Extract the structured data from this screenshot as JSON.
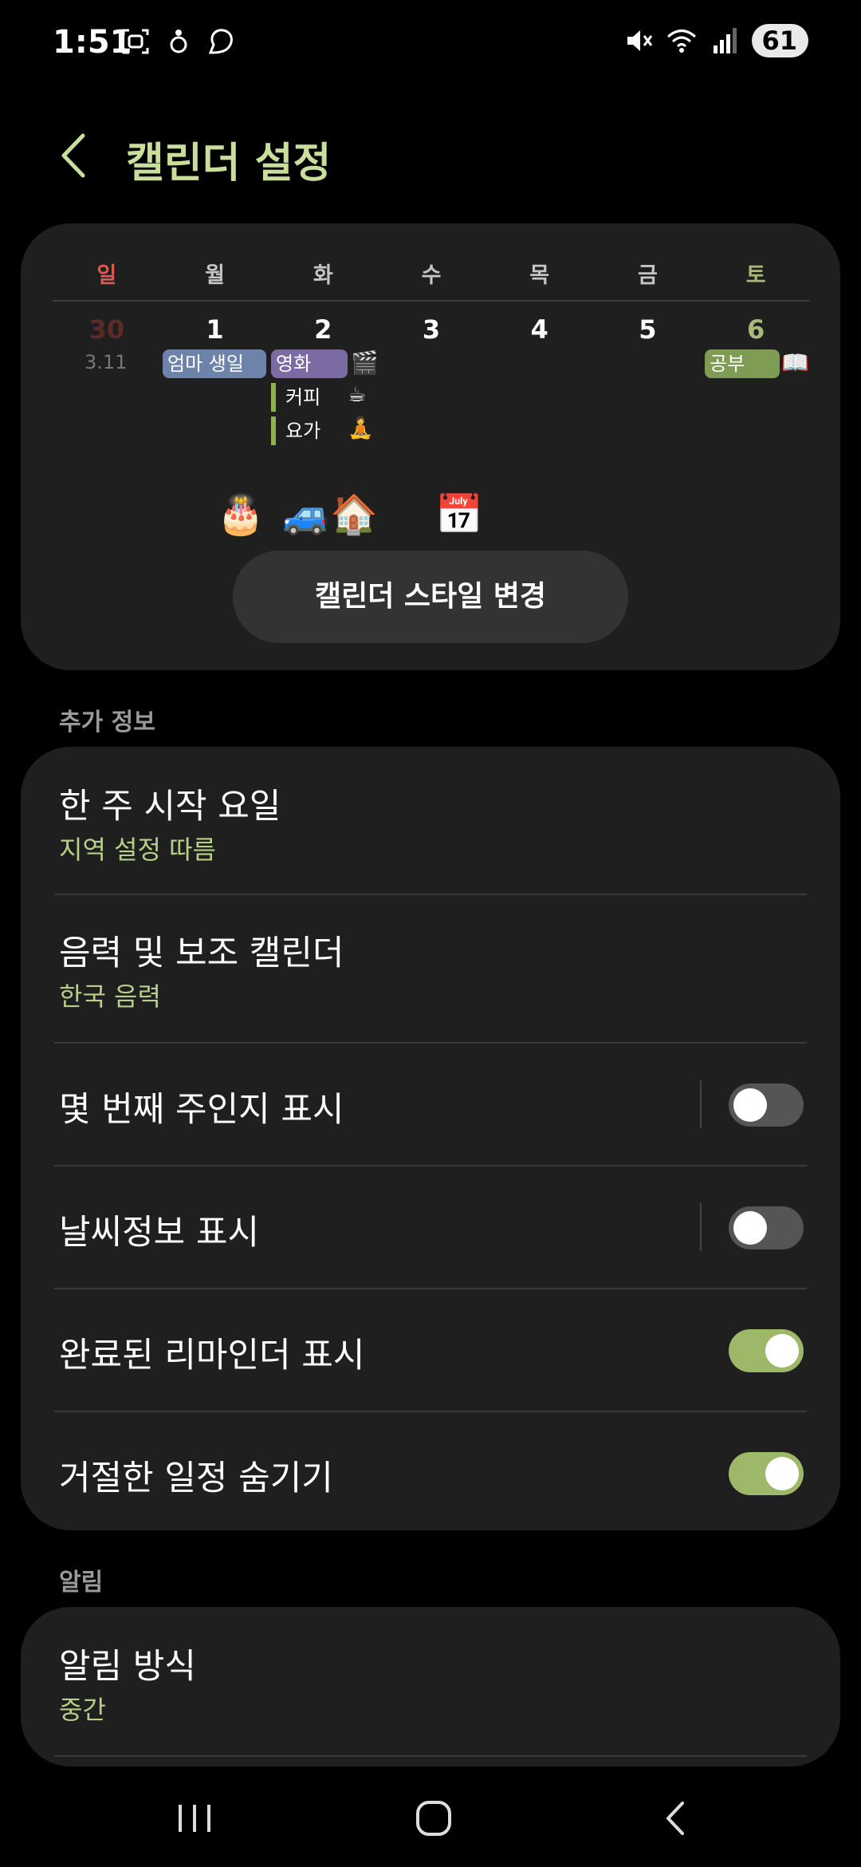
{
  "status_bar": {
    "time": "1:51",
    "battery": "61",
    "left_icons": [
      "screenshot-icon",
      "notification-icon",
      "app-notification-icon"
    ],
    "right_icons": [
      "mute-icon",
      "wifi-icon",
      "signal-icon"
    ]
  },
  "header": {
    "title": "캘린더 설정",
    "back_icon": "back-arrow-icon"
  },
  "preview": {
    "weekdays": [
      "일",
      "월",
      "화",
      "수",
      "목",
      "금",
      "토"
    ],
    "dates": [
      "30",
      "1",
      "2",
      "3",
      "4",
      "5",
      "6"
    ],
    "lunar": "3.11",
    "events": {
      "mom_birthday": "엄마 생일",
      "movie": "영화",
      "movie_emoji": "🎬",
      "study": "공부",
      "study_emoji": "📖"
    },
    "tasks": {
      "coffee": "커피",
      "coffee_emoji": "☕",
      "yoga": "요가",
      "yoga_emoji": "🧘"
    },
    "decorations": [
      "🎂",
      "🚙",
      "🏠",
      "📅"
    ],
    "style_button": "캘린더 스타일 변경"
  },
  "sections": {
    "extra_info": "추가 정보",
    "notifications": "알림"
  },
  "settings": {
    "week_start": {
      "title": "한 주 시작 요일",
      "value": "지역 설정 따름"
    },
    "lunar_calendar": {
      "title": "음력 및 보조 캘린더",
      "value": "한국 음력"
    },
    "week_number": {
      "title": "몇 번째 주인지 표시",
      "on": false
    },
    "weather": {
      "title": "날씨정보 표시",
      "on": false
    },
    "completed_reminders": {
      "title": "완료된 리마인더 표시",
      "on": true
    },
    "hide_declined": {
      "title": "거절한 일정 숨기기",
      "on": true
    }
  },
  "notifications": {
    "alert_style": {
      "title": "알림 방식",
      "value": "중간"
    }
  },
  "colors": {
    "accent": "#c9dd9c",
    "toggle_on": "#9cb868",
    "sunday": "#e0584f",
    "saturday": "#a7b87a"
  },
  "navbar": {
    "icons": [
      "recent-apps-icon",
      "home-icon",
      "back-icon"
    ]
  }
}
